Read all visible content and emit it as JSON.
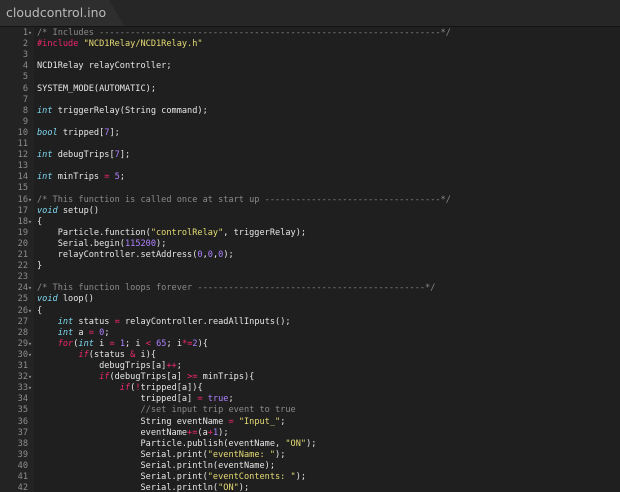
{
  "tab": {
    "title": "cloudcontrol.ino"
  },
  "editor": {
    "lines": [
      {
        "n": "1",
        "fold": "▾",
        "tokens": [
          [
            "cmt",
            "/* Includes ------------------------------------------------------------------*/"
          ]
        ]
      },
      {
        "n": "2",
        "fold": "",
        "tokens": [
          [
            "pre",
            "#include "
          ],
          [
            "str",
            "\"NCD1Relay/NCD1Relay.h\""
          ]
        ]
      },
      {
        "n": "3",
        "fold": "",
        "tokens": []
      },
      {
        "n": "4",
        "fold": "",
        "tokens": [
          [
            "plain",
            "NCD1Relay relayController;"
          ]
        ]
      },
      {
        "n": "5",
        "fold": "",
        "tokens": []
      },
      {
        "n": "6",
        "fold": "",
        "tokens": [
          [
            "plain",
            "SYSTEM_MODE(AUTOMATIC);"
          ]
        ]
      },
      {
        "n": "7",
        "fold": "",
        "tokens": []
      },
      {
        "n": "8",
        "fold": "",
        "tokens": [
          [
            "type",
            "int"
          ],
          [
            "plain",
            " triggerRelay(String command);"
          ]
        ]
      },
      {
        "n": "9",
        "fold": "",
        "tokens": []
      },
      {
        "n": "10",
        "fold": "",
        "tokens": [
          [
            "type",
            "bool"
          ],
          [
            "plain",
            " tripped["
          ],
          [
            "num",
            "7"
          ],
          [
            "plain",
            "];"
          ]
        ]
      },
      {
        "n": "11",
        "fold": "",
        "tokens": []
      },
      {
        "n": "12",
        "fold": "",
        "tokens": [
          [
            "type",
            "int"
          ],
          [
            "plain",
            " debugTrips["
          ],
          [
            "num",
            "7"
          ],
          [
            "plain",
            "];"
          ]
        ]
      },
      {
        "n": "13",
        "fold": "",
        "tokens": []
      },
      {
        "n": "14",
        "fold": "",
        "tokens": [
          [
            "type",
            "int"
          ],
          [
            "plain",
            " minTrips "
          ],
          [
            "op",
            "="
          ],
          [
            "plain",
            " "
          ],
          [
            "num",
            "5"
          ],
          [
            "plain",
            ";"
          ]
        ]
      },
      {
        "n": "15",
        "fold": "",
        "tokens": []
      },
      {
        "n": "16",
        "fold": "▾",
        "tokens": [
          [
            "cmt",
            "/* This function is called once at start up ----------------------------------*/"
          ]
        ]
      },
      {
        "n": "17",
        "fold": "",
        "tokens": [
          [
            "type",
            "void"
          ],
          [
            "plain",
            " setup()"
          ]
        ]
      },
      {
        "n": "18",
        "fold": "▾",
        "tokens": [
          [
            "plain",
            "{"
          ]
        ]
      },
      {
        "n": "19",
        "fold": "",
        "tokens": [
          [
            "plain",
            "    Particle.function("
          ],
          [
            "str",
            "\"controlRelay\""
          ],
          [
            "plain",
            ", triggerRelay);"
          ]
        ]
      },
      {
        "n": "20",
        "fold": "",
        "tokens": [
          [
            "plain",
            "    Serial.begin("
          ],
          [
            "num",
            "115200"
          ],
          [
            "plain",
            ");"
          ]
        ]
      },
      {
        "n": "21",
        "fold": "",
        "tokens": [
          [
            "plain",
            "    relayController.setAddress("
          ],
          [
            "num",
            "0"
          ],
          [
            "plain",
            ","
          ],
          [
            "num",
            "0"
          ],
          [
            "plain",
            ","
          ],
          [
            "num",
            "0"
          ],
          [
            "plain",
            ");"
          ]
        ]
      },
      {
        "n": "22",
        "fold": "",
        "tokens": [
          [
            "plain",
            "}"
          ]
        ]
      },
      {
        "n": "23",
        "fold": "",
        "tokens": []
      },
      {
        "n": "24",
        "fold": "▾",
        "tokens": [
          [
            "cmt",
            "/* This function loops forever --------------------------------------------*/"
          ]
        ]
      },
      {
        "n": "25",
        "fold": "",
        "tokens": [
          [
            "type",
            "void"
          ],
          [
            "plain",
            " loop()"
          ]
        ]
      },
      {
        "n": "26",
        "fold": "▾",
        "tokens": [
          [
            "plain",
            "{"
          ]
        ]
      },
      {
        "n": "27",
        "fold": "",
        "tokens": [
          [
            "plain",
            "    "
          ],
          [
            "type",
            "int"
          ],
          [
            "plain",
            " status "
          ],
          [
            "op",
            "="
          ],
          [
            "plain",
            " relayController.readAllInputs();"
          ]
        ]
      },
      {
        "n": "28",
        "fold": "",
        "tokens": [
          [
            "plain",
            "    "
          ],
          [
            "type",
            "int"
          ],
          [
            "plain",
            " a "
          ],
          [
            "op",
            "="
          ],
          [
            "plain",
            " "
          ],
          [
            "num",
            "0"
          ],
          [
            "plain",
            ";"
          ]
        ]
      },
      {
        "n": "29",
        "fold": "▾",
        "tokens": [
          [
            "plain",
            "    "
          ],
          [
            "kw",
            "for"
          ],
          [
            "plain",
            "("
          ],
          [
            "type",
            "int"
          ],
          [
            "plain",
            " i "
          ],
          [
            "op",
            "="
          ],
          [
            "plain",
            " "
          ],
          [
            "num",
            "1"
          ],
          [
            "plain",
            "; i "
          ],
          [
            "op",
            "<"
          ],
          [
            "plain",
            " "
          ],
          [
            "num",
            "65"
          ],
          [
            "plain",
            "; i"
          ],
          [
            "op",
            "*="
          ],
          [
            "num",
            "2"
          ],
          [
            "plain",
            "){"
          ]
        ]
      },
      {
        "n": "30",
        "fold": "▾",
        "tokens": [
          [
            "plain",
            "        "
          ],
          [
            "kw",
            "if"
          ],
          [
            "plain",
            "(status "
          ],
          [
            "op",
            "&"
          ],
          [
            "plain",
            " i){"
          ]
        ]
      },
      {
        "n": "31",
        "fold": "",
        "tokens": [
          [
            "plain",
            "            debugTrips[a]"
          ],
          [
            "op",
            "++"
          ],
          [
            "plain",
            ";"
          ]
        ]
      },
      {
        "n": "32",
        "fold": "▾",
        "tokens": [
          [
            "plain",
            "            "
          ],
          [
            "kw",
            "if"
          ],
          [
            "plain",
            "(debugTrips[a] "
          ],
          [
            "op",
            ">="
          ],
          [
            "plain",
            " minTrips){"
          ]
        ]
      },
      {
        "n": "33",
        "fold": "▾",
        "tokens": [
          [
            "plain",
            "                "
          ],
          [
            "kw",
            "if"
          ],
          [
            "plain",
            "("
          ],
          [
            "op",
            "!"
          ],
          [
            "plain",
            "tripped[a]){"
          ]
        ]
      },
      {
        "n": "34",
        "fold": "",
        "tokens": [
          [
            "plain",
            "                    tripped[a] "
          ],
          [
            "op",
            "="
          ],
          [
            "plain",
            " "
          ],
          [
            "num",
            "true"
          ],
          [
            "plain",
            ";"
          ]
        ]
      },
      {
        "n": "35",
        "fold": "",
        "tokens": [
          [
            "plain",
            "                    "
          ],
          [
            "cmt",
            "//set input trip event to true"
          ]
        ]
      },
      {
        "n": "36",
        "fold": "",
        "tokens": [
          [
            "plain",
            "                    String eventName "
          ],
          [
            "op",
            "="
          ],
          [
            "plain",
            " "
          ],
          [
            "str",
            "\"Input_\""
          ],
          [
            "plain",
            ";"
          ]
        ]
      },
      {
        "n": "37",
        "fold": "",
        "tokens": [
          [
            "plain",
            "                    eventName"
          ],
          [
            "op",
            "+="
          ],
          [
            "plain",
            "(a"
          ],
          [
            "op",
            "+"
          ],
          [
            "num",
            "1"
          ],
          [
            "plain",
            ");"
          ]
        ]
      },
      {
        "n": "38",
        "fold": "",
        "tokens": [
          [
            "plain",
            "                    Particle.publish(eventName, "
          ],
          [
            "str",
            "\"ON\""
          ],
          [
            "plain",
            ");"
          ]
        ]
      },
      {
        "n": "39",
        "fold": "",
        "tokens": [
          [
            "plain",
            "                    Serial.print("
          ],
          [
            "str",
            "\"eventName: \""
          ],
          [
            "plain",
            ");"
          ]
        ]
      },
      {
        "n": "40",
        "fold": "",
        "tokens": [
          [
            "plain",
            "                    Serial.println(eventName);"
          ]
        ]
      },
      {
        "n": "41",
        "fold": "",
        "tokens": [
          [
            "plain",
            "                    Serial.print("
          ],
          [
            "str",
            "\"eventContents: \""
          ],
          [
            "plain",
            ");"
          ]
        ]
      },
      {
        "n": "42",
        "fold": "",
        "tokens": [
          [
            "plain",
            "                    Serial.println("
          ],
          [
            "str",
            "\"ON\""
          ],
          [
            "plain",
            ");"
          ]
        ]
      }
    ]
  }
}
